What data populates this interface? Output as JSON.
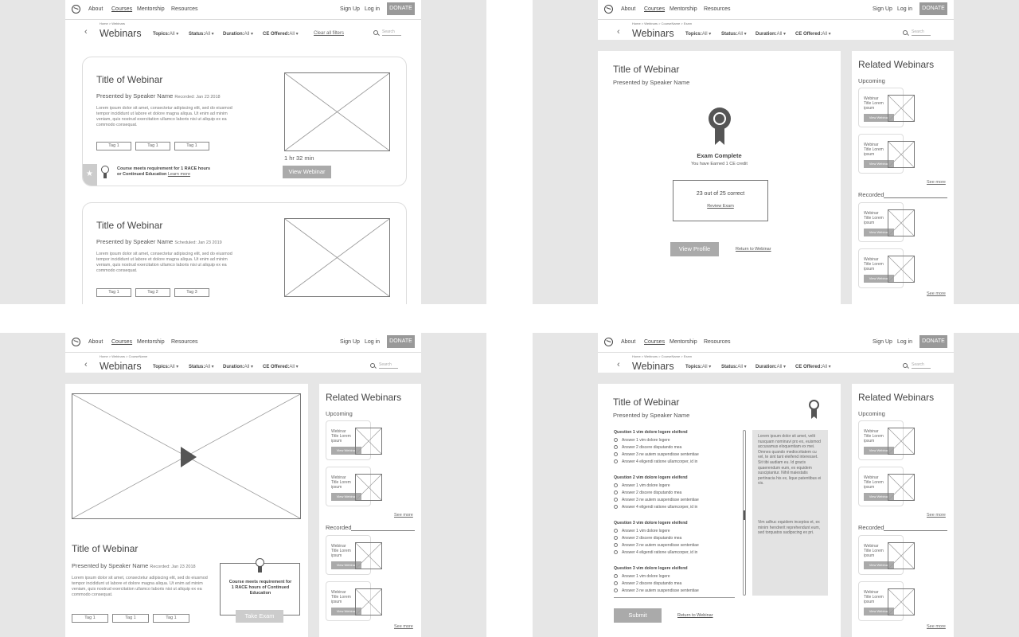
{
  "nav": {
    "about": "About",
    "courses": "Courses",
    "mentorship": "Mentorship",
    "resources": "Resources",
    "sign_up": "Sign Up",
    "log_in": "Log in",
    "donate": "DONATE"
  },
  "header": {
    "title": "Webinars",
    "search_placeholder": "Search",
    "topics": "Topics:",
    "status": "Status:",
    "duration": "Duration:",
    "ce_offered": "CE Offered:",
    "all": "All",
    "clear_filters": "Clear all filters"
  },
  "breadcrumbs": {
    "list": "Home > Webinars",
    "detail": "Home > Webinars > CourseName",
    "exam": "Home > Webinars > CourseName > Exam"
  },
  "webinar": {
    "title": "Title of Webinar",
    "presenter": "Presented by Speaker Name",
    "recorded": "Recorded: Jan 23 2018",
    "scheduled": "Scheduled: Jan 23 2019",
    "description": "Lorem ipsum dolor sit amet, consectetur adipiscing elit, sed do eiusmod tempor incididunt ut labore et dolore magna aliqua. Ut enim ad minim veniam, quis nostrud exercitation ullamco laboris nisi ut aliquip ex ea commodo consequat.",
    "tag1": "Tag 1",
    "tag2": "Tag 2",
    "tag3": "Tag 3",
    "duration": "1 hr 32 min",
    "view_button": "View Webinar",
    "ce_note": "Course meets requirement for 1 RACE hours or Continued Education",
    "learn_more": "Learn more",
    "detail_ce_note": "Course meets requirement for 1 RACE hours of Continued Education",
    "take_exam": "Take Exam"
  },
  "related": {
    "title": "Related Webinars",
    "upcoming": "Upcoming",
    "recorded": "Recorded",
    "card_title_a": "Webinar Title Lorem ipsum",
    "card_title_b": "Webinar Title Lorem ipsum",
    "card_button": "View Webinar",
    "see_more": "See more"
  },
  "exam_complete": {
    "heading": "Exam Complete",
    "earned": "You have Earned 1 CE credit",
    "score": "23 out of 25 correct",
    "review": "Review Exam",
    "view_profile": "View Profile",
    "return": "Return to Webinar"
  },
  "exam": {
    "questions": [
      {
        "label": "Question 1 vim dolore logere eleifend"
      },
      {
        "label": "Question 2 vim dolore logere eleifend"
      },
      {
        "label": "Question 3 vim dolore logere eleifend"
      },
      {
        "label": "Question 3 vim dolore logere eleifend"
      }
    ],
    "answers": [
      "Answer 1 vim dolore logere",
      "Answer 2 discere disputando mea",
      "Answer 3 ne autem suspendisse sententiae",
      "Answer 4 eligendi ratione ullamcorper, id in"
    ],
    "side_text": "Lorem ipsum dolor sit amet, velit nusquam nominavi pro ex, euismod accusamus eloquentiam ex mei. Omnes quando mediocritatem cu vel, te sint tant eleifend interesset. Sit tibi audiam eu. Id gracis quaerendum eum, ex equidem suscipiantur. Nihil maiestatis pertinacia his ex, lique patentibus ei vis.",
    "side_text2": "Vim adhuc equidem inceptos et, ex minim hendrerit reprehendunt eum, sed torquatos sadipscing ex pri.",
    "submit": "Submit",
    "return": "Return to Webinar"
  }
}
